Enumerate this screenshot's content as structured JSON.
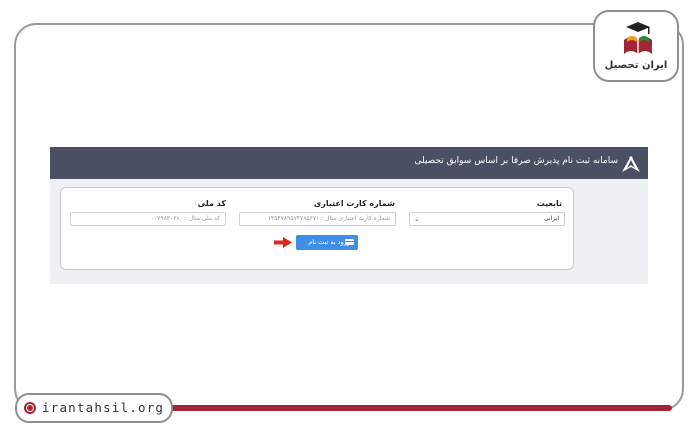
{
  "brand": {
    "logo_text": "ایران تحصیل",
    "site_url": "irantahsil.org",
    "accent_color": "#a32638"
  },
  "header": {
    "title": "سامانه ثبت نام پذیرش صرفا بر اساس سوابق تحصیلی",
    "bg_color": "#4b4f63"
  },
  "form": {
    "nationality": {
      "label": "تابعیت",
      "value": "ایرانی"
    },
    "card_number": {
      "label": "شماره کارت اعتباری",
      "placeholder": "شماره کارت اعتباری مثال : ۱۳۵۴۷۸۹۵۷۴۷۸۵۶۷۱"
    },
    "national_code": {
      "label": "کد ملی",
      "placeholder": "کد ملی مثال : ۰۰۷۹۸۳۰۳۸۰"
    },
    "submit_button": {
      "label": "ورود به ثبت نام",
      "color": "#3f8ee8"
    }
  },
  "icons": {
    "header_logo": "university-emblem-icon",
    "submit_icon": "credit-card-icon",
    "pointer": "red-arrow-icon",
    "site_icon": "globe-icon",
    "brand_logo": "book-graduation-icon"
  }
}
